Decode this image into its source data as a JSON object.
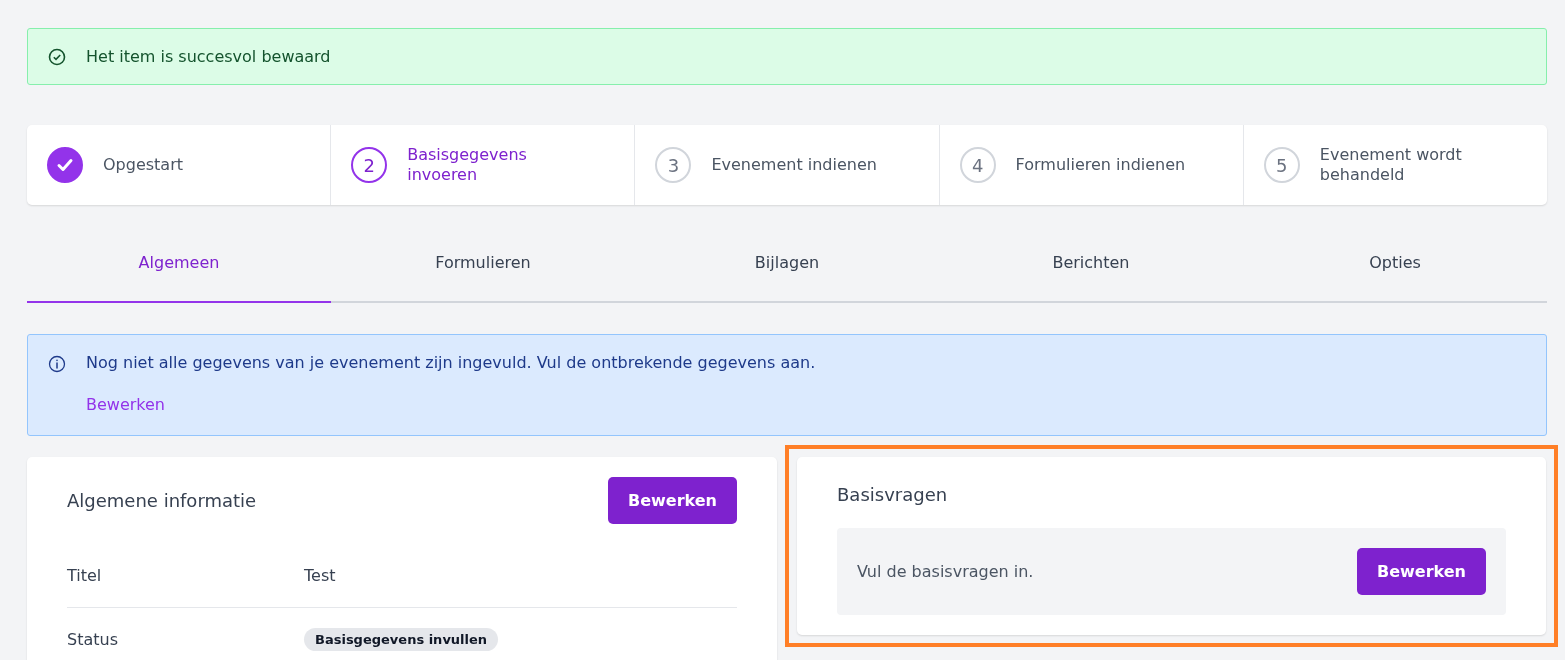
{
  "success_alert": {
    "message": "Het item is succesvol bewaard"
  },
  "steps": [
    {
      "label": "Opgestart",
      "completed": true,
      "selected": false
    },
    {
      "number": "2",
      "label": "Basisgegevens invoeren",
      "completed": false,
      "selected": true
    },
    {
      "number": "3",
      "label": "Evenement indienen",
      "completed": false,
      "selected": false
    },
    {
      "number": "4",
      "label": "Formulieren indienen",
      "completed": false,
      "selected": false
    },
    {
      "number": "5",
      "label": "Evenement wordt behandeld",
      "completed": false,
      "selected": false
    }
  ],
  "tabs": [
    {
      "label": "Algemeen",
      "selected": true
    },
    {
      "label": "Formulieren",
      "selected": false
    },
    {
      "label": "Bijlagen",
      "selected": false
    },
    {
      "label": "Berichten",
      "selected": false
    },
    {
      "label": "Opties",
      "selected": false
    }
  ],
  "info_alert": {
    "message": "Nog niet alle gegevens van je evenement zijn ingevuld. Vul de ontbrekende gegevens aan.",
    "link": "Bewerken"
  },
  "general_card": {
    "title": "Algemene informatie",
    "button": "Bewerken",
    "rows": [
      {
        "label": "Titel",
        "value": "Test",
        "kind": "text"
      },
      {
        "label": "Status",
        "value": "Basisgegevens invullen",
        "kind": "badge"
      }
    ]
  },
  "questions_card": {
    "title": "Basisvragen",
    "highlighted": true,
    "message": "Vul de basisvragen in.",
    "button": "Bewerken"
  }
}
